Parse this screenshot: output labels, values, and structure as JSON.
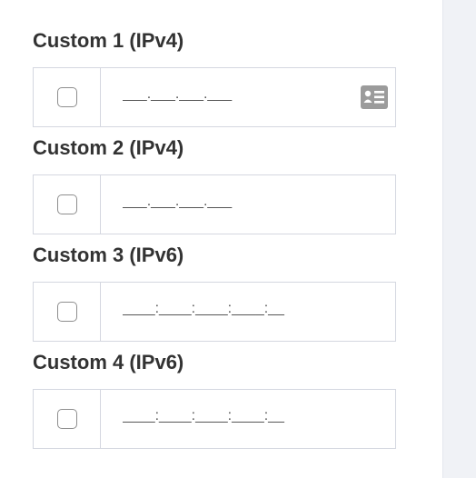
{
  "fields": [
    {
      "label": "Custom 1 (IPv4)",
      "placeholder": "___.___.___.___",
      "has_contact_icon": true
    },
    {
      "label": "Custom 2 (IPv4)",
      "placeholder": "___.___.___.___",
      "has_contact_icon": false
    },
    {
      "label": "Custom 3 (IPv6)",
      "placeholder": "____:____:____:____:__",
      "has_contact_icon": false
    },
    {
      "label": "Custom 4 (IPv6)",
      "placeholder": "____:____:____:____:__",
      "has_contact_icon": false
    }
  ],
  "icons": {
    "contact": "contact-card-icon"
  },
  "colors": {
    "label": "#333333",
    "border": "#d4d7e0",
    "icon": "#9b9b9b",
    "panel": "#f0f2f6"
  }
}
